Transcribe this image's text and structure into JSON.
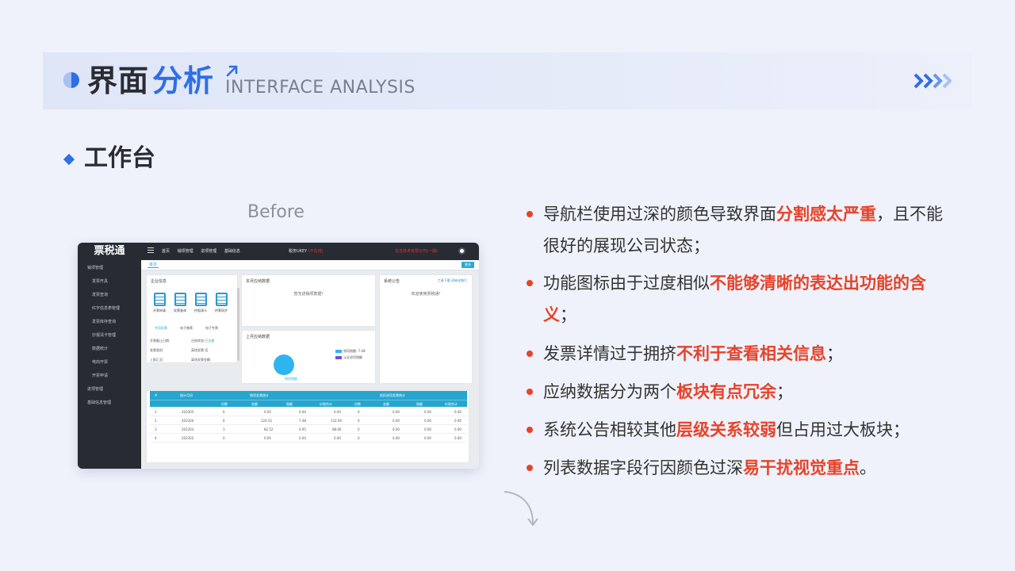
{
  "header": {
    "title_part1": "界面",
    "title_part2": "分析",
    "title_en": "INTERFACE ANALYSIS",
    "accent_color": "#2f6ee6"
  },
  "section": {
    "subtitle": "工作台",
    "before_label": "Before"
  },
  "screenshot": {
    "logo": "票税通",
    "sidebar_items": [
      "销项管理",
      "发票开具",
      "发票查询",
      "红字信息表管理",
      "发票库存查询",
      "抄报清卡管理",
      "数据统计",
      "电商开票",
      "开票申请",
      "进项管理",
      "基础信息管理"
    ],
    "top_nav": [
      "首页",
      "销项管理",
      "进项管理",
      "基础信息"
    ],
    "ukey_label": "税务UKEY",
    "ukey_status": "(不在线)",
    "company": "信息技术有限公司(一期)",
    "tab": "首页",
    "more_button": "更多",
    "enterprise_card": {
      "title": "企业信息",
      "icons": [
        "开票申请",
        "发票查询",
        "抄报清卡",
        "供票同步"
      ],
      "tabs": [
        "专用发票",
        "电子普票",
        "电子专票"
      ],
      "fields": [
        {
          "label": "开票截止日期:",
          "value": ""
        },
        {
          "label": "注册状态:",
          "value": "已注册"
        },
        {
          "label": "发票类别:",
          "value": ""
        },
        {
          "label": "离线发票:",
          "value": "否"
        },
        {
          "label": "上报汇总:",
          "value": ""
        },
        {
          "label": "离线发票金额:",
          "value": ""
        },
        {
          "label": "远程清卡:",
          "value": ""
        },
        {
          "label": "离线发票时间:",
          "value": ""
        }
      ]
    },
    "month_card": {
      "title": "本月应纳数据",
      "empty": "暂无进销项数据!"
    },
    "announce_card": {
      "title": "系统公告",
      "links": [
        "工具下载",
        "初始化指引"
      ],
      "welcome": "欢迎使用票税通!"
    },
    "prev_month_card": {
      "title": "上月应纳数据",
      "legend": [
        "销项税额: 7.48",
        "认证进项税额"
      ],
      "circle_label": "销项税额"
    },
    "table": {
      "col_index": "#",
      "col_period": "统计月份",
      "group1": "销项发票统计",
      "group2": "抵扣进项发票统计",
      "sub_headers": [
        "份数",
        "金额",
        "税额",
        "价税合计",
        "份数",
        "金额",
        "税额",
        "价税合计"
      ],
      "rows": [
        [
          "1",
          "202305",
          "0",
          "0.00",
          "0.00",
          "0.00",
          "0",
          "0.00",
          "0.00",
          "0.00"
        ],
        [
          "2",
          "202304",
          "6",
          "124.52",
          "7.48",
          "132.00",
          "0",
          "0.00",
          "0.00",
          "0.00"
        ],
        [
          "3",
          "202303",
          "3",
          "82.52",
          "4.95",
          "88.00",
          "0",
          "0.00",
          "0.00",
          "0.00"
        ],
        [
          "4",
          "202302",
          "0",
          "0.00",
          "0.00",
          "0.00",
          "0",
          "0.00",
          "0.00",
          "0.00"
        ]
      ]
    }
  },
  "bullets": [
    {
      "pre": "导航栏使用过深的颜色导致界面",
      "hl": "分割感太严重",
      "post": "，且不能很好的展现公司状态；"
    },
    {
      "pre": "功能图标由于过度相似",
      "hl": "不能够清晰的表达出功能的含义",
      "post": "；"
    },
    {
      "pre": "发票详情过于拥挤",
      "hl": "不利于查看相关信息",
      "post": "；"
    },
    {
      "pre": "应纳数据分为两个",
      "hl": "板块有点冗余",
      "post": "；"
    },
    {
      "pre": "系统公告相较其他",
      "hl": "层级关系较弱",
      "post": "但占用过大板块；"
    },
    {
      "pre": "列表数据字段行因颜色过深",
      "hl": "易干扰视觉重点",
      "post": "。"
    }
  ],
  "colors": {
    "highlight": "#e5432a",
    "sidebar": "#272b33",
    "table_header": "#26a6cf"
  }
}
